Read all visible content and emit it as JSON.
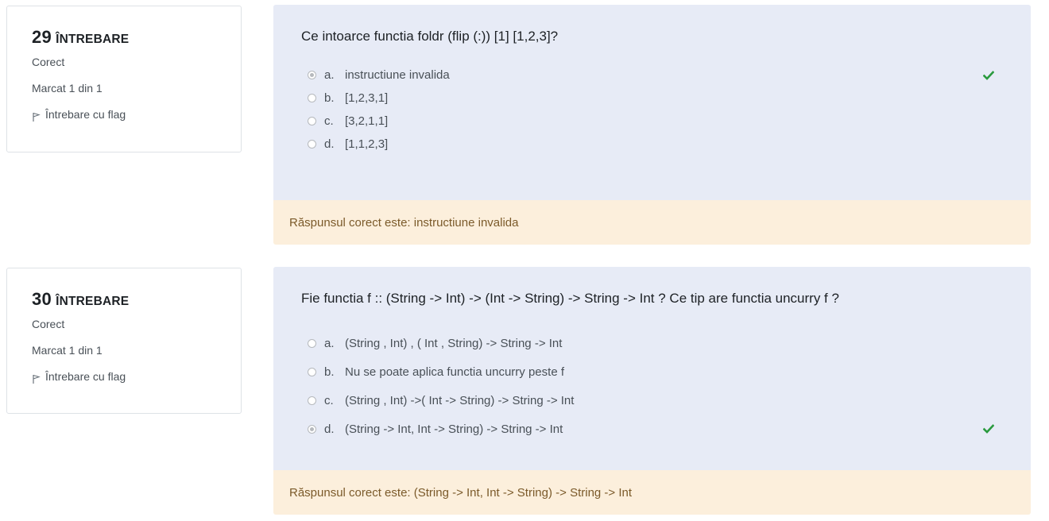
{
  "questions": [
    {
      "number": "29",
      "word": "ÎNTREBARE",
      "state": "Corect",
      "grade": "Marcat 1 din 1",
      "flag_label": "Întrebare cu flag",
      "text": "Ce intoarce functia foldr (flip (:)) [1] [1,2,3]?",
      "options": [
        {
          "letter": "a.",
          "text": "instructiune invalida",
          "selected": true
        },
        {
          "letter": "b.",
          "text": "[1,2,3,1]",
          "selected": false
        },
        {
          "letter": "c.",
          "text": "[3,2,1,1]",
          "selected": false
        },
        {
          "letter": "d.",
          "text": "[1,1,2,3]",
          "selected": false
        }
      ],
      "feedback": "Răspunsul corect este: instructiune invalida"
    },
    {
      "number": "30",
      "word": "ÎNTREBARE",
      "state": "Corect",
      "grade": "Marcat 1 din 1",
      "flag_label": "Întrebare cu flag",
      "text": "Fie functia f :: (String -> Int) -> (Int -> String) -> String -> Int ? Ce tip are functia uncurry f ?",
      "options": [
        {
          "letter": "a.",
          "text": "(String , Int) , ( Int , String) -> String -> Int",
          "selected": false
        },
        {
          "letter": "b.",
          "text": "Nu se poate aplica functia uncurry peste f",
          "selected": false
        },
        {
          "letter": "c.",
          "text": "(String , Int) ->( Int -> String) -> String -> Int",
          "selected": false
        },
        {
          "letter": "d.",
          "text": "(String -> Int, Int -> String) -> String -> Int",
          "selected": true
        }
      ],
      "feedback": "Răspunsul corect este: (String -> Int, Int -> String) -> String -> Int"
    }
  ],
  "colors": {
    "formulation_bg": "#e7ebf6",
    "feedback_bg": "#fcefdc",
    "correct_icon": "#2a9a3e"
  },
  "icons": {
    "correct": "check-icon",
    "flag": "flag-icon"
  }
}
